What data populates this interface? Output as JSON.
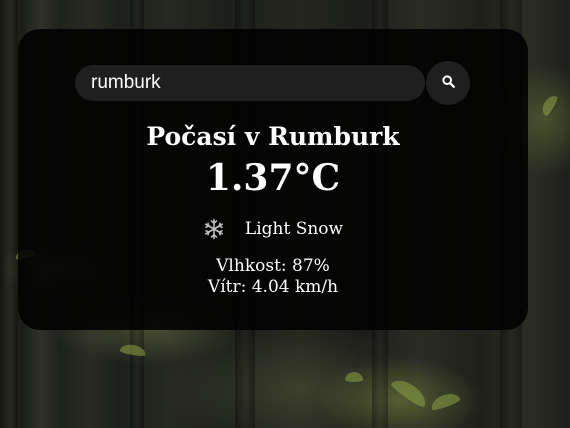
{
  "search": {
    "value": "rumburk",
    "placeholder": ""
  },
  "weather": {
    "city_title": "Počasí v Rumburk",
    "temperature": "1.37°C",
    "icon": "snowflake-icon",
    "description": "Light Snow",
    "humidity": "Vlhkost: 87%",
    "wind": "Vítr: 4.04 km/h"
  },
  "colors": {
    "card_background": "#000000",
    "input_background": "#1f1f1f",
    "text": "#ffffff"
  }
}
